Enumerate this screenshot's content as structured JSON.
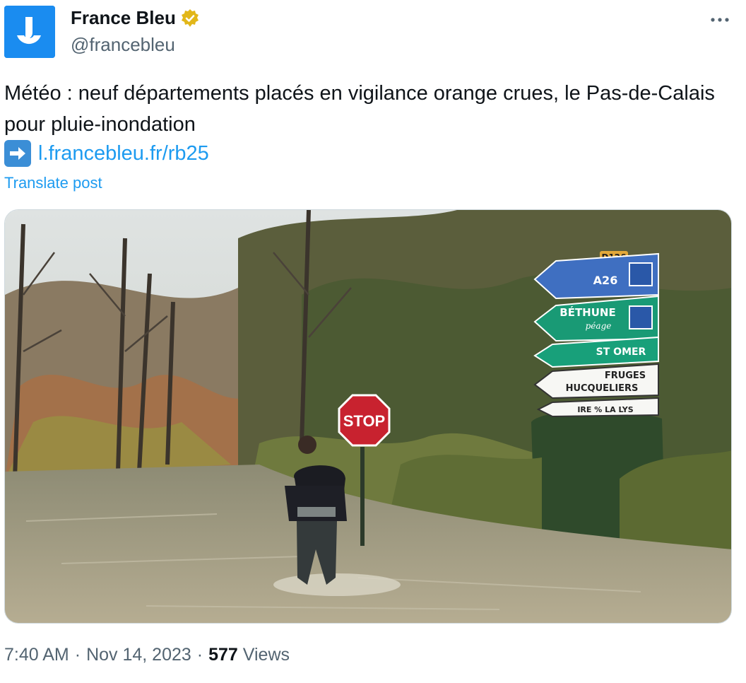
{
  "account": {
    "display_name": "France Bleu",
    "handle": "@francebleu",
    "verified": true,
    "avatar_bg": "#1a8cf0"
  },
  "post": {
    "text": "Météo : neuf départements placés en vigilance orange crues, le Pas-de-Calais pour pluie-inondation",
    "link_emoji": "right-arrow-icon",
    "link_text": "l.francebleu.fr/rb25",
    "translate_label": "Translate post"
  },
  "media": {
    "signs": {
      "road_plate": "D126",
      "sign1": "A26",
      "sign2": "BÉTHUNE",
      "sign2_sub": "péage",
      "sign3": "ST OMER",
      "sign4_line1": "FRUGES",
      "sign4_line2": "HUCQUELIERS",
      "sign5": "IRE % LA LYS",
      "stop": "STOP"
    }
  },
  "meta": {
    "time": "7:40 AM",
    "sep1": "·",
    "date": "Nov 14, 2023",
    "sep2": "·",
    "views_count": "577",
    "views_label": "Views"
  },
  "colors": {
    "link": "#1d9bf0",
    "secondary_text": "#536471",
    "verified_badge": "#e2b719"
  }
}
